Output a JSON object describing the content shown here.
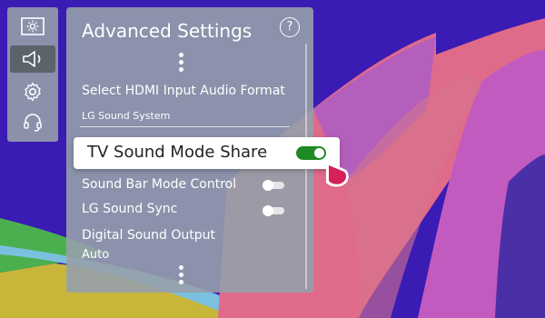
{
  "sidebar": {
    "items": [
      {
        "icon": "picture-icon",
        "selected": false
      },
      {
        "icon": "speaker-icon",
        "selected": true
      },
      {
        "icon": "gear-icon",
        "selected": false
      },
      {
        "icon": "headset-icon",
        "selected": false
      }
    ]
  },
  "panel": {
    "title": "Advanced Settings",
    "help_glyph": "?",
    "items": [
      {
        "label": "Select HDMI Input Audio Format",
        "value": "LG Sound System"
      },
      {
        "label": "TV Sound Mode Share",
        "toggle": true,
        "focused": true
      },
      {
        "label": "Sound Bar Mode Control",
        "toggle": false
      },
      {
        "label": "LG Sound Sync",
        "toggle": false
      },
      {
        "label": "Digital Sound Output",
        "value": "Auto"
      }
    ]
  },
  "colors": {
    "toggle_on": "#1f8a23",
    "cursor": "#d6205a",
    "panel_bg": "#969fa9"
  }
}
